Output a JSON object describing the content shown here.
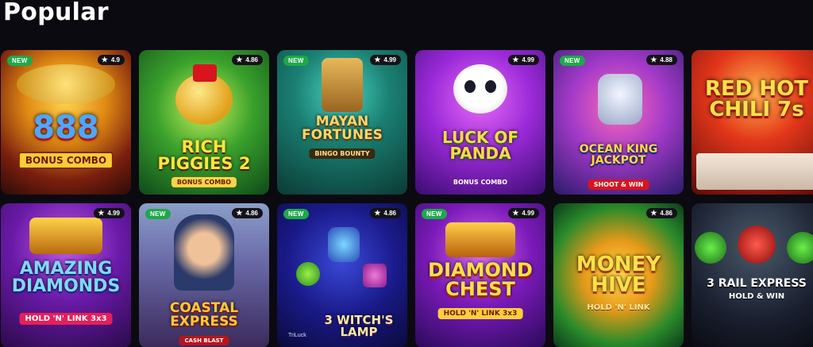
{
  "section": {
    "title": "Popular"
  },
  "games": [
    {
      "title": "888",
      "subtitle": "BONUS COMBO",
      "new_badge": "NEW",
      "rating": "4.9"
    },
    {
      "title": "RICH PIGGIES 2",
      "subtitle": "BONUS COMBO",
      "new_badge": "",
      "rating": "4.86"
    },
    {
      "title": "MAYAN FORTUNES",
      "subtitle": "BINGO BOUNTY",
      "new_badge": "NEW",
      "rating": "4.99"
    },
    {
      "title": "LUCK OF PANDA",
      "subtitle": "BONUS COMBO",
      "new_badge": "",
      "rating": "4.99"
    },
    {
      "title": "OCEAN KING JACKPOT",
      "subtitle": "SHOOT & WIN",
      "new_badge": "NEW",
      "rating": "4.88"
    },
    {
      "title": "RED HOT CHILI 7s",
      "subtitle": "",
      "new_badge": "",
      "rating": ""
    },
    {
      "title": "AMAZING DIAMONDS",
      "subtitle": "HOLD 'N' LINK 3x3",
      "new_badge": "",
      "rating": "4.99"
    },
    {
      "title": "COASTAL EXPRESS",
      "subtitle": "CASH BLAST",
      "new_badge": "NEW",
      "rating": "4.86"
    },
    {
      "title": "3 WITCH'S LAMP",
      "subtitle": "",
      "brand": "TriLuck",
      "new_badge": "NEW",
      "rating": "4.86"
    },
    {
      "title": "DIAMOND CHEST",
      "subtitle": "HOLD 'N' LINK 3x3",
      "new_badge": "NEW",
      "rating": "4.99"
    },
    {
      "title": "MONEY HIVE",
      "subtitle": "HOLD 'N' LINK",
      "new_badge": "",
      "rating": "4.86"
    },
    {
      "title": "3 RAIL EXPRESS",
      "subtitle": "HOLD & WIN",
      "new_badge": "",
      "rating": ""
    }
  ],
  "icons": {
    "rating": "star-icon"
  },
  "colors": {
    "background": "#0b0a10",
    "new_badge": "#1ea84a",
    "rating_pill": "#141218"
  }
}
